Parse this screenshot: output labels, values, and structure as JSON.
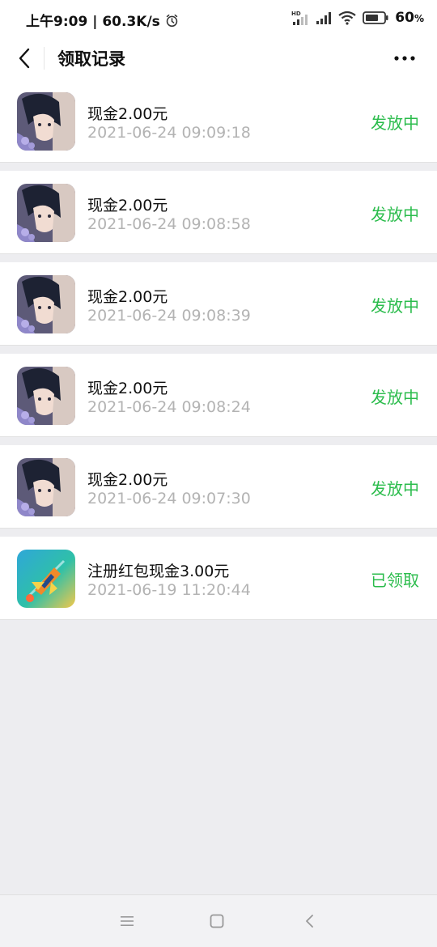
{
  "status_bar": {
    "time_speed": "上午9:09 | 60.3K/s",
    "network_label": "HD",
    "battery_value": "60",
    "battery_unit": "%"
  },
  "header": {
    "title": "领取记录"
  },
  "colors": {
    "status_green": "#2bbc4c",
    "timestamp_gray": "#b3b3b3",
    "background": "#ededf0"
  },
  "records": [
    {
      "title": "现金2.00元",
      "time": "2021-06-24 09:09:18",
      "status": "发放中",
      "icon": "anime-game-avatar"
    },
    {
      "title": "现金2.00元",
      "time": "2021-06-24 09:08:58",
      "status": "发放中",
      "icon": "anime-game-avatar"
    },
    {
      "title": "现金2.00元",
      "time": "2021-06-24 09:08:39",
      "status": "发放中",
      "icon": "anime-game-avatar"
    },
    {
      "title": "现金2.00元",
      "time": "2021-06-24 09:08:24",
      "status": "发放中",
      "icon": "anime-game-avatar"
    },
    {
      "title": "现金2.00元",
      "time": "2021-06-24 09:07:30",
      "status": "发放中",
      "icon": "anime-game-avatar"
    },
    {
      "title": "注册红包现金3.00元",
      "time": "2021-06-19 11:20:44",
      "status": "已领取",
      "icon": "spaceship-game-avatar"
    }
  ],
  "nav": {
    "icons": [
      "menu-icon",
      "home-icon",
      "back-icon"
    ]
  }
}
